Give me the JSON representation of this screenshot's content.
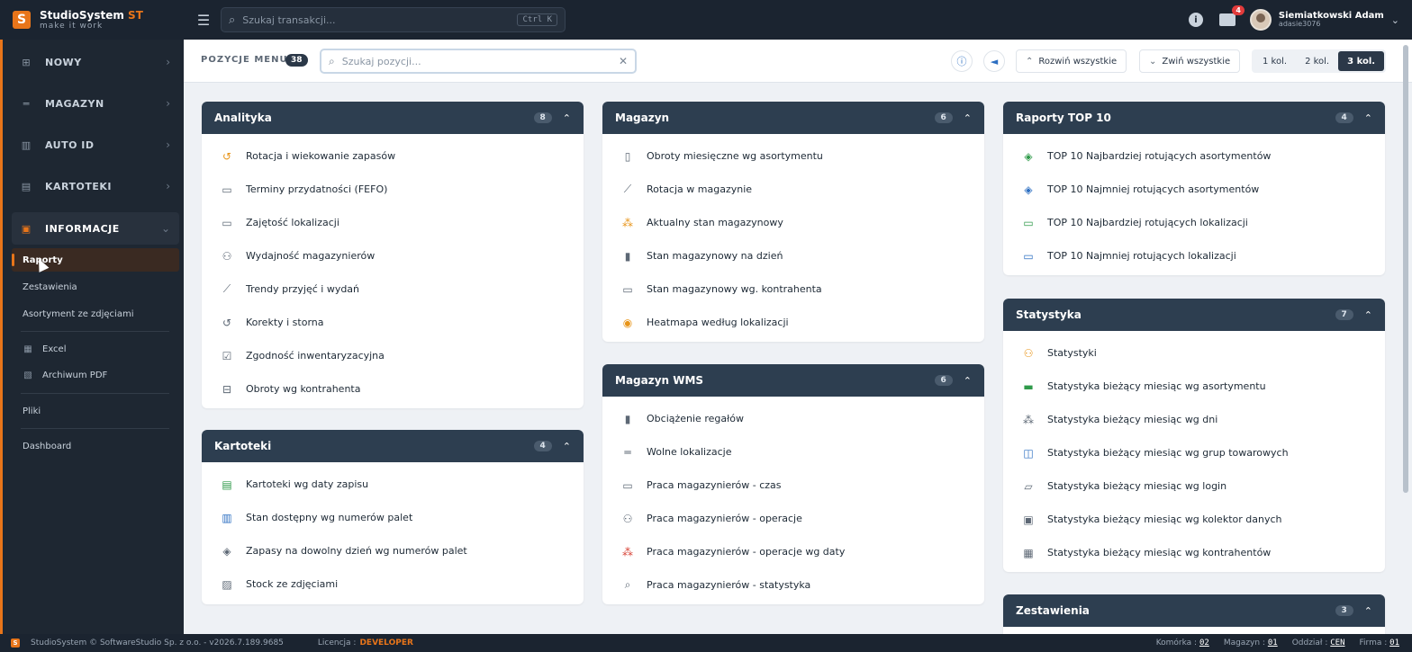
{
  "app": {
    "logo_mark": "S",
    "name": "StudioSystem",
    "name_accent": "ST",
    "tagline": "make it work"
  },
  "topbar": {
    "search_placeholder": "Szukaj transakcji...",
    "search_shortcut": "Ctrl K",
    "info_icon": "i",
    "mail_count": "4",
    "user_name": "Siemiatkowski Adam",
    "user_login": "adasie3076"
  },
  "sidebar": {
    "items": [
      {
        "label": "NOWY",
        "icon": "plus-square-icon"
      },
      {
        "label": "MAGAZYN",
        "icon": "shelf-icon"
      },
      {
        "label": "AUTO ID",
        "icon": "barcode-icon"
      },
      {
        "label": "KARTOTEKI",
        "icon": "card-icon"
      },
      {
        "label": "INFORMACJE",
        "icon": "document-icon"
      }
    ],
    "sub_items": [
      {
        "label": "Raporty"
      },
      {
        "label": "Zestawienia"
      },
      {
        "label": "Asortyment ze zdjęciami"
      },
      {
        "label": "Excel",
        "icon": "excel-icon"
      },
      {
        "label": "Archiwum PDF",
        "icon": "pdf-icon"
      },
      {
        "label": "Pliki"
      },
      {
        "label": "Dashboard"
      }
    ]
  },
  "toolbar": {
    "menu_label": "POZYCJE MENU",
    "menu_count": "38",
    "search_placeholder": "Szukaj pozycji...",
    "expand_all": "Rozwiń wszystkie",
    "collapse_all": "Zwiń wszystkie",
    "col_options": [
      "1 kol.",
      "2 kol.",
      "3 kol."
    ],
    "col_selected": "3 kol."
  },
  "cards": {
    "analityka": {
      "title": "Analityka",
      "count": "8",
      "items": [
        "Rotacja i wiekowanie zapasów",
        "Terminy przydatności (FEFO)",
        "Zajętość lokalizacji",
        "Wydajność magazynierów",
        "Trendy przyjęć i wydań",
        "Korekty i storna",
        "Zgodność inwentaryzacyjna",
        "Obroty wg kontrahenta"
      ]
    },
    "kartoteki": {
      "title": "Kartoteki",
      "count": "4",
      "items": [
        "Kartoteki wg daty zapisu",
        "Stan dostępny wg numerów palet",
        "Zapasy na dowolny dzień wg numerów palet",
        "Stock ze zdjęciami"
      ]
    },
    "magazyn": {
      "title": "Magazyn",
      "count": "6",
      "items": [
        "Obroty miesięczne wg asortymentu",
        "Rotacja w magazynie",
        "Aktualny stan magazynowy",
        "Stan magazynowy na dzień",
        "Stan magazynowy wg. kontrahenta",
        "Heatmapa według lokalizacji"
      ]
    },
    "magazyn_wms": {
      "title": "Magazyn WMS",
      "count": "6",
      "items": [
        "Obciążenie regałów",
        "Wolne lokalizacje",
        "Praca magazynierów - czas",
        "Praca magazynierów - operacje",
        "Praca magazynierów - operacje wg daty",
        "Praca magazynierów - statystyka"
      ]
    },
    "raporty_top10": {
      "title": "Raporty TOP 10",
      "count": "4",
      "items": [
        "TOP 10 Najbardziej rotujących asortymentów",
        "TOP 10 Najmniej rotujących asortymentów",
        "TOP 10 Najbardziej rotujących lokalizacji",
        "TOP 10 Najmniej rotujących lokalizacji"
      ]
    },
    "statystyka": {
      "title": "Statystyka",
      "count": "7",
      "items": [
        "Statystyki",
        "Statystyka bieżący miesiąc wg asortymentu",
        "Statystyka bieżący miesiąc wg dni",
        "Statystyka bieżący miesiąc wg grup towarowych",
        "Statystyka bieżący miesiąc wg login",
        "Statystyka bieżący miesiąc wg kolektor danych",
        "Statystyka bieżący miesiąc wg kontrahentów"
      ]
    },
    "zestawienia": {
      "title": "Zestawienia",
      "count": "3"
    }
  },
  "footer": {
    "mark": "S",
    "copyright": "StudioSystem © SoftwareStudio Sp. z o.o. - v2026.7.189.9685",
    "license_label": "Licencja :",
    "license_value": "DEVELOPER",
    "komorka_label": "Komórka :",
    "komorka_value": "02",
    "magazyn_label": "Magazyn :",
    "magazyn_value": "01",
    "oddzial_label": "Oddział :",
    "oddzial_value": "CEN",
    "firma_label": "Firma :",
    "firma_value": "01"
  },
  "colors": {
    "accent": "#e8751a",
    "dark": "#1b2430",
    "card_header": "#2d3e50",
    "background": "#eef1f5"
  }
}
